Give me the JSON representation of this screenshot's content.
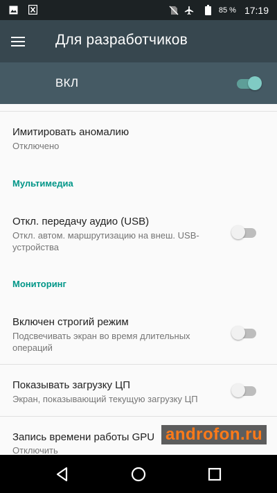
{
  "status_bar": {
    "battery": "85 %",
    "time": "17:19",
    "icons": [
      "image-notification-icon",
      "excel-notification-icon",
      "no-sim-icon",
      "airplane-mode-icon",
      "battery-icon"
    ]
  },
  "app_bar": {
    "title": "Для разработчиков"
  },
  "master_switch": {
    "label": "ВКЛ",
    "on": true
  },
  "settings": {
    "anomaly": {
      "title": "Имитировать аномалию",
      "summary": "Отключено"
    },
    "section_media": "Мультимедиа",
    "usb_audio": {
      "title": "Откл. передачу аудио (USB)",
      "summary_line1": "Откл. автом. маршрутизацию на внеш. USB-",
      "summary_line2": "устройства",
      "on": false
    },
    "section_monitoring": "Мониторинг",
    "strict_mode": {
      "title": "Включен строгий режим",
      "summary_line1": "Подсвечивать экран во время длительных",
      "summary_line2": "операций",
      "on": false
    },
    "cpu_usage": {
      "title": "Показывать загрузку ЦП",
      "summary": "Экран, показывающий текущую загрузку ЦП",
      "on": false
    },
    "gpu_profile": {
      "title": "Запись времени работы GPU",
      "summary": "Отключить"
    }
  },
  "watermark": "androfon.ru",
  "colors": {
    "status_bar": "#1c2224",
    "app_bar": "#37474f",
    "master_bar": "#455a64",
    "accent": "#009688",
    "switch_on": "#80cbc4"
  }
}
